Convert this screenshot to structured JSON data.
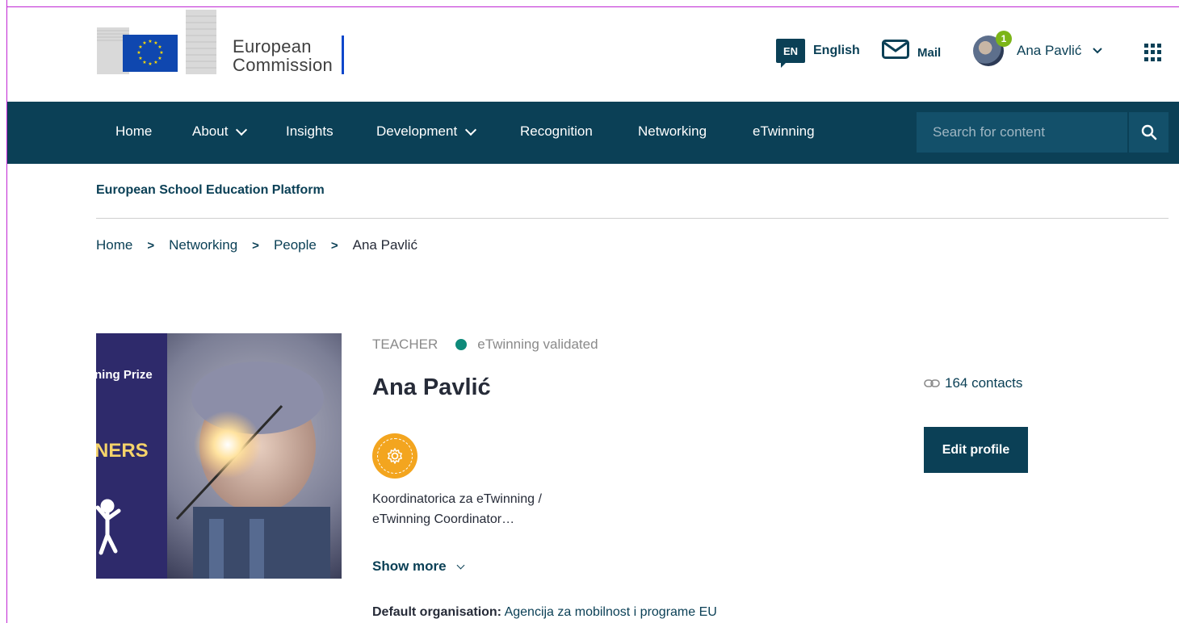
{
  "header": {
    "logo_text_line1": "European",
    "logo_text_line2": "Commission",
    "language_code": "EN",
    "language_label": "English",
    "mail_label": "Mail",
    "notification_count": "1",
    "user_name": "Ana Pavlić",
    "icons": [
      "eu-flag-icon",
      "mail-icon",
      "chevron-down-icon",
      "apps-grid-icon"
    ]
  },
  "nav": {
    "items": [
      {
        "label": "Home"
      },
      {
        "label": "About",
        "dropdown": true
      },
      {
        "label": "Insights"
      },
      {
        "label": "Development",
        "dropdown": true
      },
      {
        "label": "Recognition"
      },
      {
        "label": "Networking"
      },
      {
        "label": "eTwinning"
      }
    ],
    "search_placeholder": "Search for content"
  },
  "site": {
    "name": "European School Education Platform"
  },
  "breadcrumb": {
    "items": [
      "Home",
      "Networking",
      "People"
    ],
    "current": "Ana Pavlić"
  },
  "profile": {
    "image_caption_lines": [
      "ning Prize",
      "NERS"
    ],
    "role": "TEACHER",
    "validation": "eTwinning validated",
    "name": "Ana Pavlić",
    "bio_line1": "Koordinatorica za eTwinning /",
    "bio_line2": "eTwinning Coordinator…",
    "show_more": "Show more",
    "org_label": "Default organisation:",
    "org_value": "Agencija za mobilnost i programe EU",
    "contacts": "164 contacts",
    "edit_label": "Edit profile"
  },
  "colors": {
    "primary": "#0b4056",
    "badge": "#f3a51f",
    "validated_dot": "#0e8a7a",
    "notification": "#7cb518"
  }
}
